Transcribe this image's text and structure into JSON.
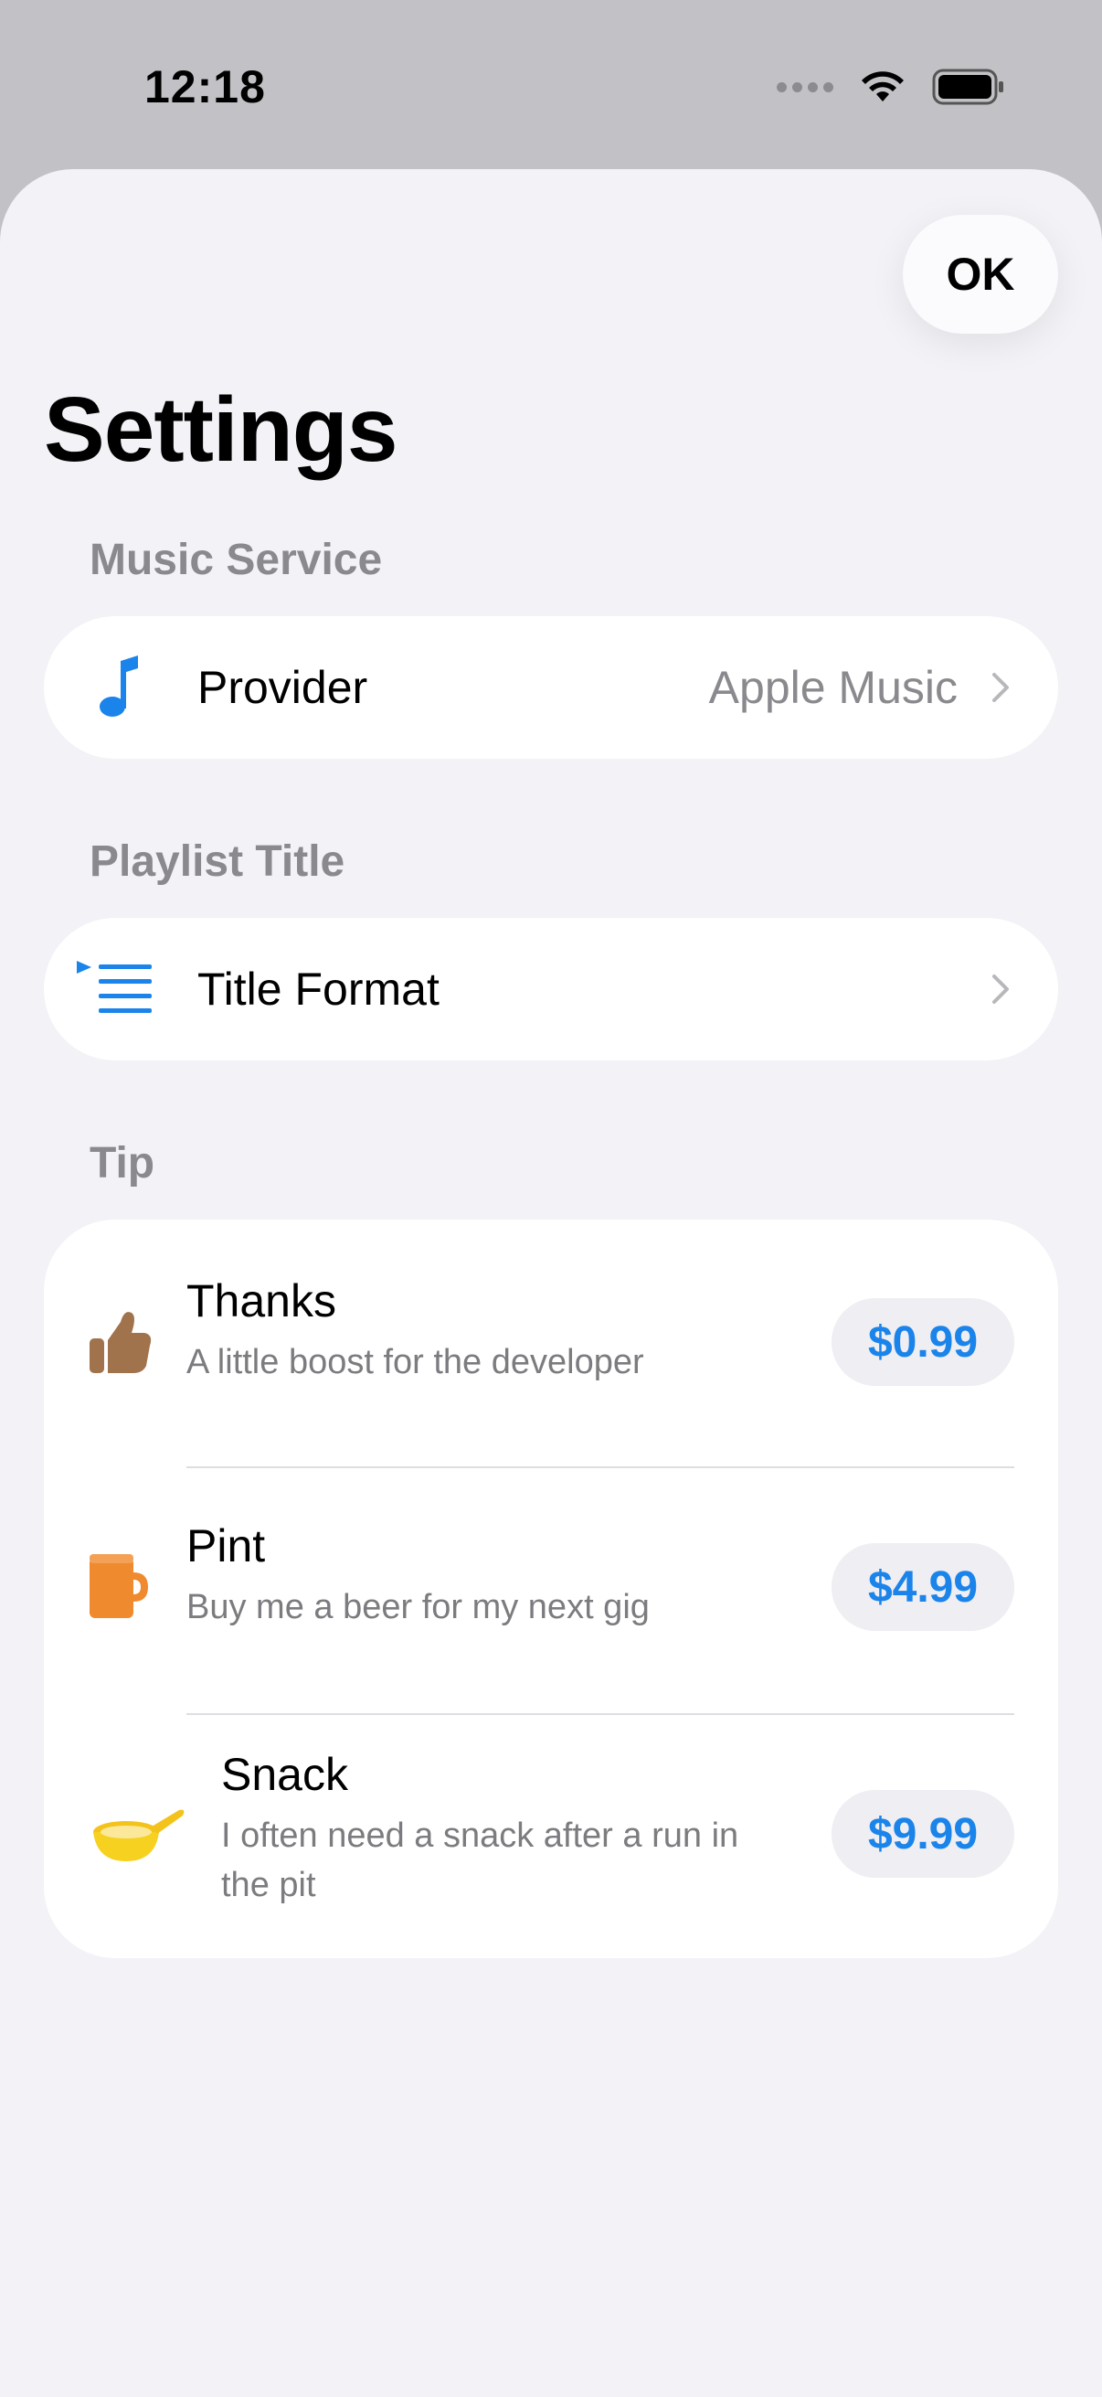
{
  "status_bar": {
    "time": "12:18"
  },
  "header": {
    "ok_label": "OK",
    "title": "Settings"
  },
  "music_service": {
    "section_label": "Music Service",
    "provider_label": "Provider",
    "provider_value": "Apple Music",
    "icon": "music-note-icon"
  },
  "playlist_title": {
    "section_label": "Playlist Title",
    "format_label": "Title Format",
    "icon": "list-icon"
  },
  "tip": {
    "section_label": "Tip",
    "items": [
      {
        "title": "Thanks",
        "description": "A little boost for the developer",
        "price": "$0.99",
        "icon": "thumbs-up-icon"
      },
      {
        "title": "Pint",
        "description": "Buy me a beer for my next gig",
        "price": "$4.99",
        "icon": "mug-icon"
      },
      {
        "title": "Snack",
        "description_line1": "I often need a snack after a run in",
        "description_line2": "the pit",
        "price": "$9.99",
        "icon": "bowl-icon"
      }
    ]
  },
  "colors": {
    "accent": "#1b84ea",
    "background": "#f2f2f7",
    "secondary_text": "#8a8a8e"
  }
}
